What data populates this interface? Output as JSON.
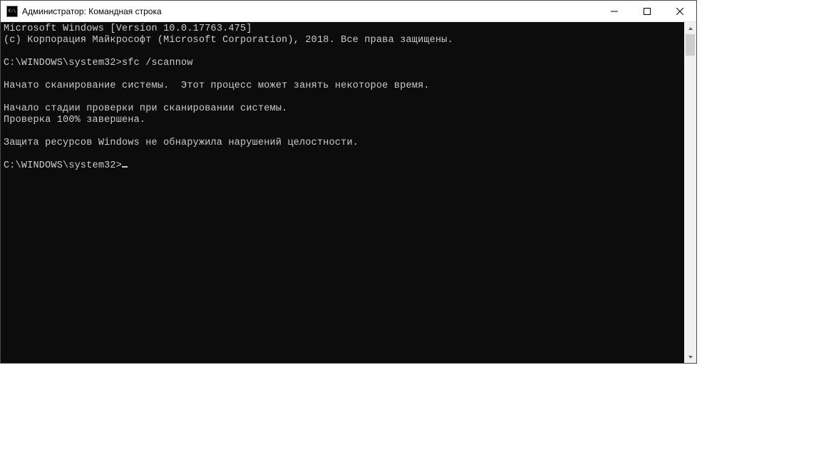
{
  "window": {
    "title": "Администратор: Командная строка"
  },
  "terminal": {
    "line1": "Microsoft Windows [Version 10.0.17763.475]",
    "line2": "(c) Корпорация Майкрософт (Microsoft Corporation), 2018. Все права защищены.",
    "blank1": "",
    "prompt1_path": "C:\\WINDOWS\\system32>",
    "prompt1_cmd": "sfc /scannow",
    "blank2": "",
    "line3": "Начато сканирование системы.  Этот процесс может занять некоторое время.",
    "blank3": "",
    "line4": "Начало стадии проверки при сканировании системы.",
    "line5": "Проверка 100% завершена.",
    "blank4": "",
    "line6": "Защита ресурсов Windows не обнаружила нарушений целостности.",
    "blank5": "",
    "prompt2_path": "C:\\WINDOWS\\system32>"
  }
}
